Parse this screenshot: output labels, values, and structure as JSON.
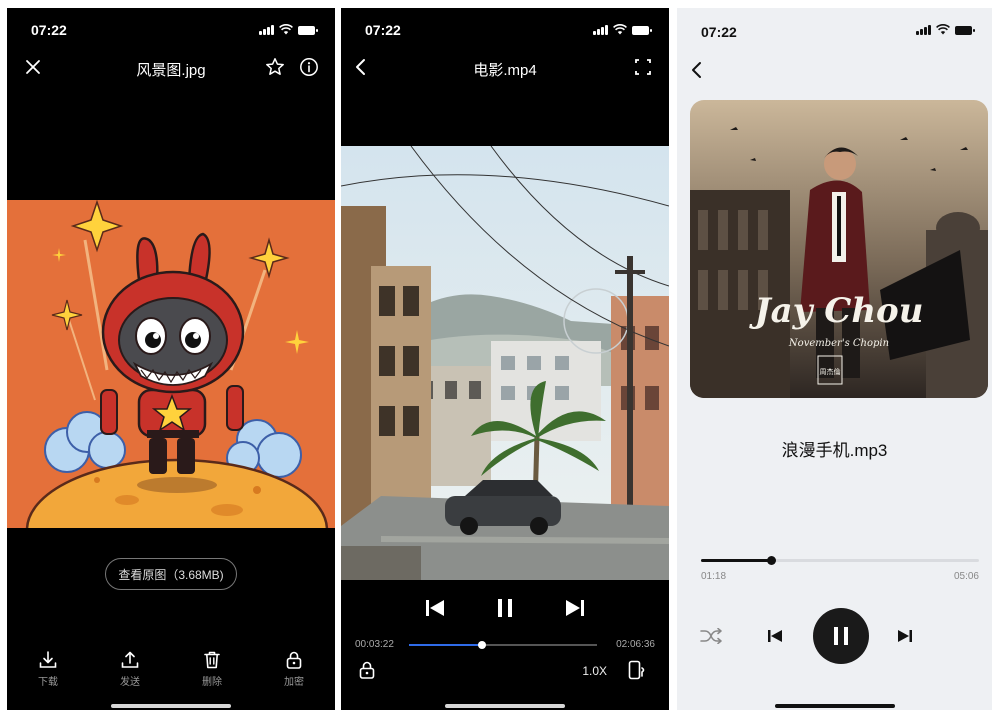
{
  "status_time": "07:22",
  "image_viewer": {
    "title": "风景图.jpg",
    "view_original_button": "查看原图（3.68MB)",
    "actions": [
      {
        "label": "下载",
        "icon": "download-icon"
      },
      {
        "label": "发送",
        "icon": "share-icon"
      },
      {
        "label": "删除",
        "icon": "trash-icon"
      },
      {
        "label": "加密",
        "icon": "lock-icon"
      }
    ],
    "colors": {
      "background": "#000000",
      "artwork_bg": "#e4703a"
    }
  },
  "video_player": {
    "title": "电影.mp4",
    "current_time": "00:03:22",
    "total_time": "02:06:36",
    "progress": 0.39,
    "speed": "1.0X",
    "colors": {
      "accent": "#2f6be8"
    }
  },
  "music_player": {
    "song_title": "浪漫手机.mp3",
    "current_time": "01:18",
    "total_time": "05:06",
    "progress": 0.25,
    "album_art": {
      "artist_title": "Jay Chou",
      "subtitle": "November's Chopin",
      "badge": "周杰倫"
    },
    "colors": {
      "background": "#eef0f3",
      "control": "#1a1a1a"
    }
  }
}
